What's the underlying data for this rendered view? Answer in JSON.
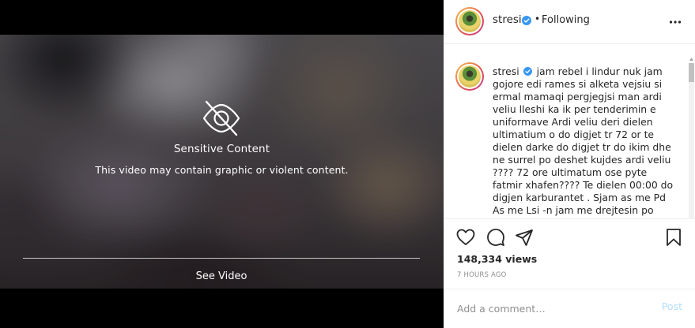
{
  "media": {
    "sensitive_title": "Sensitive Content",
    "sensitive_desc": "This video may contain graphic or violent content.",
    "see_video_label": "See Video"
  },
  "header": {
    "username": "stresi",
    "separator": "•",
    "follow_status": "Following"
  },
  "caption": {
    "username": "stresi",
    "text": "jam rebel i lindur nuk jam gojore edi rames si alketa vejsiu si ermal mamaqi pergjegjsi man ardi veliu lleshi ka ik per tenderimin e uniformave Ardi veliu deri dielen ultimatium o do digjet tr 72 or te dielen darke do digjet tr do ikim dhe ne surrel po deshet kujdes ardi veliu ???? 72 ore ultimatum ose pyte fatmir xhafen???? Te dielen 00:00 do digjen karburantet . Sjam as me Pd As me Lsi -n jam me drejtesin po"
  },
  "actions": {
    "views": "148,334 views",
    "time": "7 HOURS AGO"
  },
  "comment": {
    "placeholder": "Add a comment…",
    "post_label": "Post"
  },
  "colors": {
    "verified": "#3897f0",
    "post_disabled": "#b2dffc",
    "muted_text": "#8e8e8e"
  },
  "icons": [
    "eye-slash-icon",
    "verified-icon",
    "more-icon",
    "heart-icon",
    "comment-icon",
    "share-icon",
    "bookmark-icon"
  ]
}
